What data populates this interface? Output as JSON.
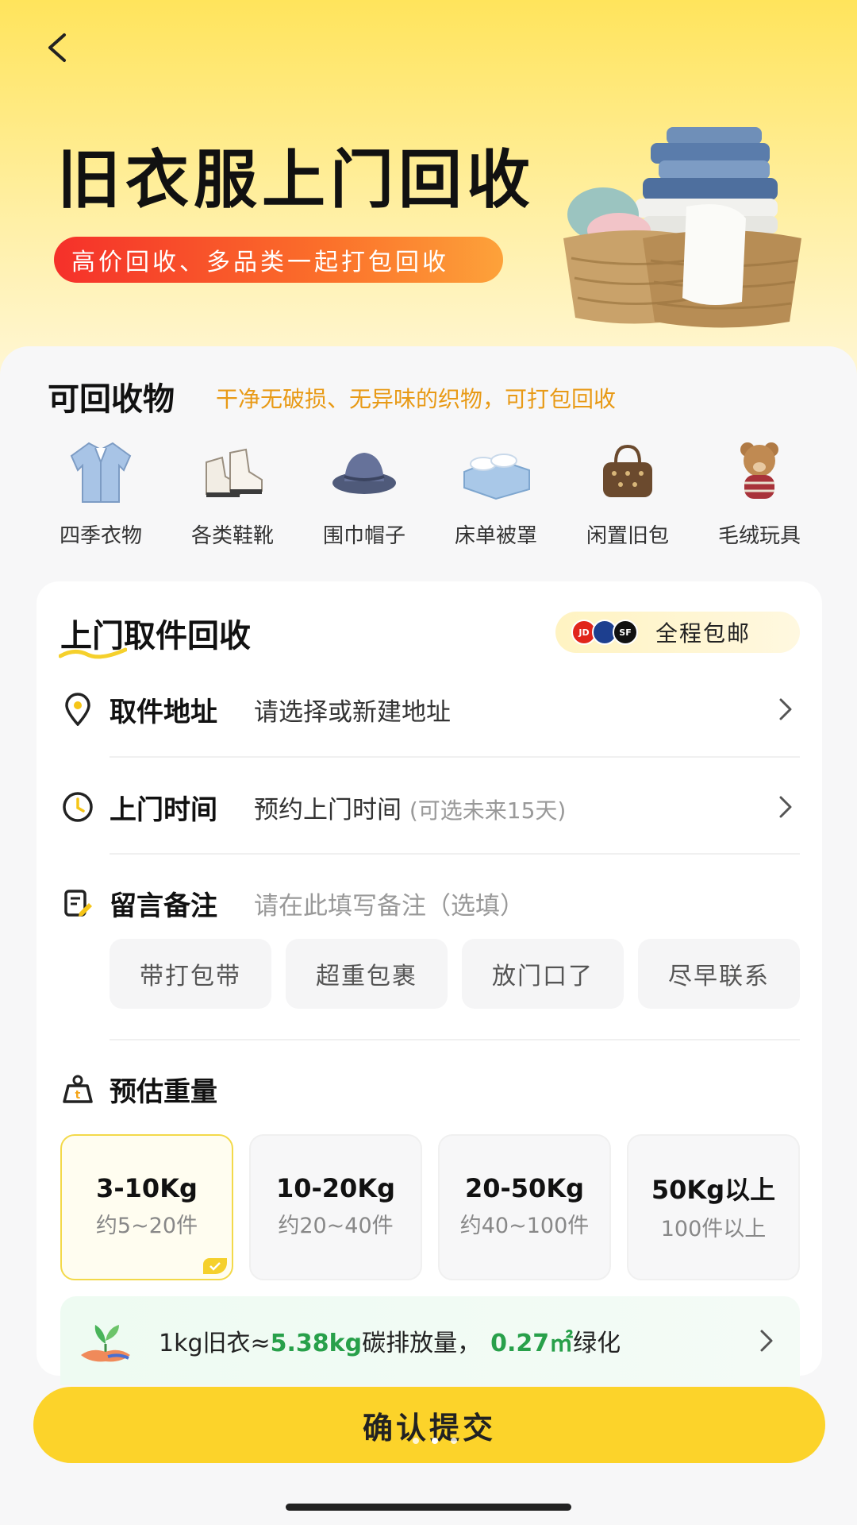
{
  "hero": {
    "title": "旧衣服上门回收",
    "subtitle": "高价回收、多品类一起打包回收"
  },
  "recyclables": {
    "title": "可回收物",
    "note": "干净无破损、无异味的织物，可打包回收",
    "items": [
      {
        "label": "四季衣物",
        "icon": "jacket-icon"
      },
      {
        "label": "各类鞋靴",
        "icon": "boots-icon"
      },
      {
        "label": "围巾帽子",
        "icon": "hat-icon"
      },
      {
        "label": "床单被罩",
        "icon": "bedding-icon"
      },
      {
        "label": "闲置旧包",
        "icon": "handbag-icon"
      },
      {
        "label": "毛绒玩具",
        "icon": "teddy-bear-icon"
      }
    ]
  },
  "pickup": {
    "title": "上门取件回收",
    "shipping_badge": "全程包邮",
    "shipping_logos": [
      "JD",
      "SF"
    ],
    "address": {
      "label": "取件地址",
      "value": "请选择或新建地址"
    },
    "time": {
      "label": "上门时间",
      "value": "预约上门时间",
      "sub": "(可选未来15天)"
    },
    "note": {
      "label": "留言备注",
      "placeholder": "请在此填写备注（选填）"
    },
    "chips": [
      "带打包带",
      "超重包裹",
      "放门口了",
      "尽早联系"
    ]
  },
  "weight": {
    "title": "预估重量",
    "options": [
      {
        "main": "3-10Kg",
        "sub": "约5~20件",
        "selected": true
      },
      {
        "main": "10-20Kg",
        "sub": "约20~40件",
        "selected": false
      },
      {
        "main": "20-50Kg",
        "sub": "约40~100件",
        "selected": false
      },
      {
        "main": "50Kg以上",
        "sub": "100件以上",
        "selected": false
      }
    ]
  },
  "carbon": {
    "prefix": "1kg旧衣≈",
    "value1": "5.38kg",
    "mid": "碳排放量，",
    "value2": "0.27㎡",
    "suffix": "绿化"
  },
  "submit_label": "确认提交",
  "colors": {
    "accent_yellow": "#fcd32a",
    "note_orange": "#e89a16",
    "green": "#28a04a"
  }
}
